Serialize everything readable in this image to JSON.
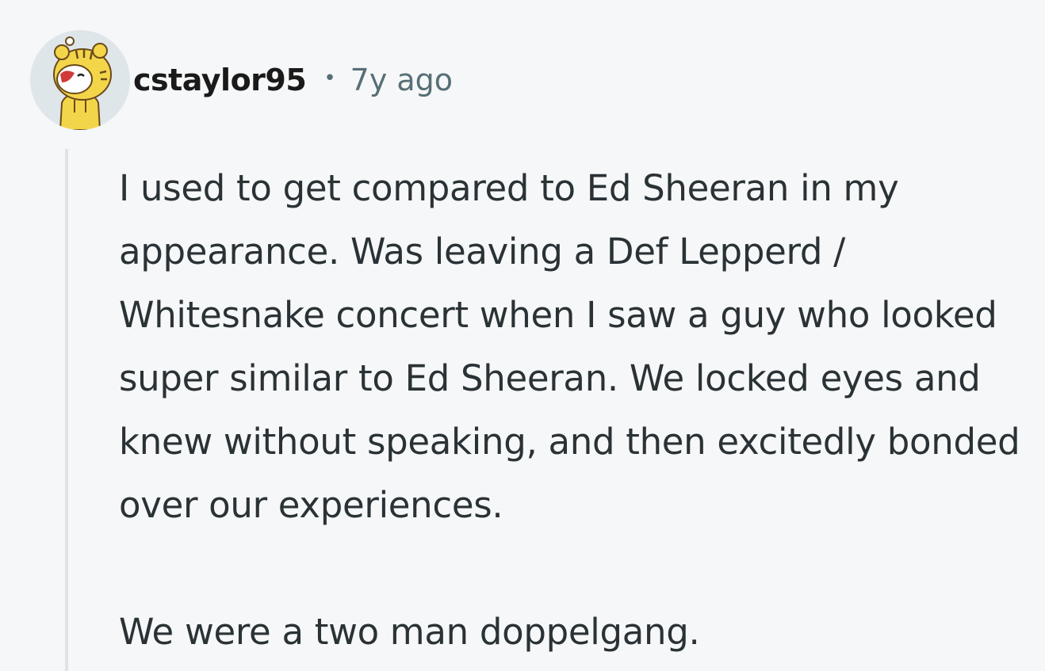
{
  "comment": {
    "author": "cstaylor95",
    "separator": "•",
    "timestamp": "7y ago",
    "avatar_icon": "snoo-tiger-costume-avatar-icon",
    "paragraphs": [
      "I used to get compared to Ed Sheeran in my appearance. Was leaving a Def Lepperd / Whitesnake concert when I saw a guy who looked super similar to Ed Sheeran. We locked eyes and knew without speaking, and then excitedly bonded over our experiences.",
      "We were a two man doppelgang."
    ]
  },
  "colors": {
    "background": "#f6f7f8",
    "text": "#2a3236",
    "author": "#1a1a1b",
    "meta": "#576f76",
    "thread_line": "#dfe3e8"
  }
}
